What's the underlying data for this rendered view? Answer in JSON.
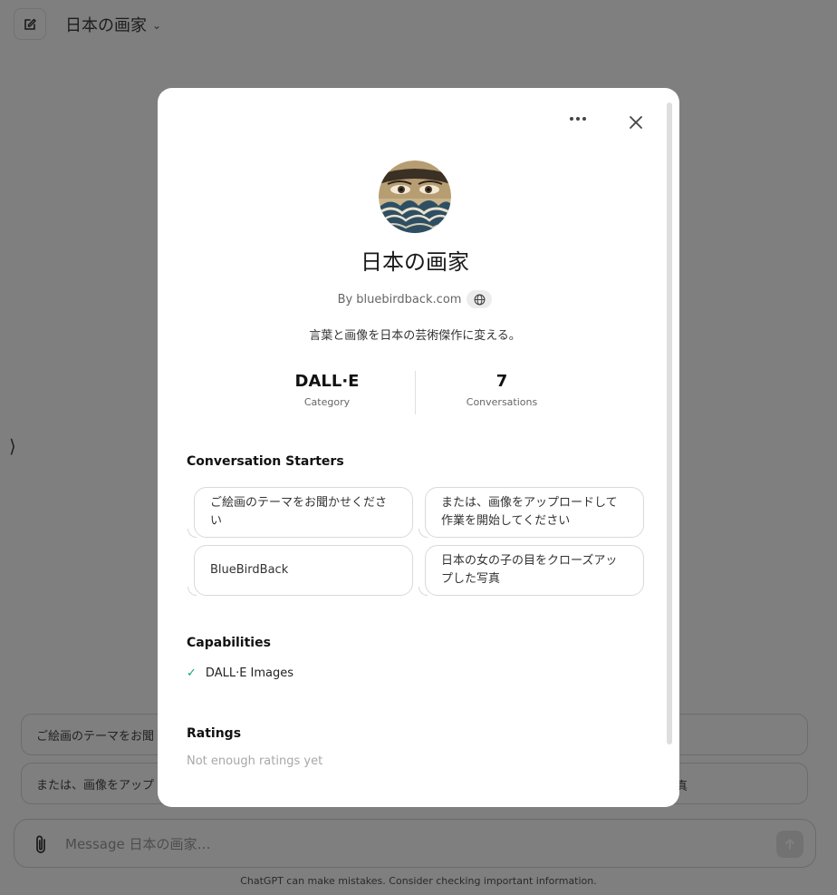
{
  "header": {
    "title": "日本の画家"
  },
  "background_starters": [
    {
      "text": "ご絵画のテーマをお聞"
    },
    {
      "text": "または、画像をアップ"
    },
    {
      "text": "真"
    }
  ],
  "composer": {
    "placeholder": "Message 日本の画家…",
    "disclaimer": "ChatGPT can make mistakes. Consider checking important information."
  },
  "modal": {
    "name": "日本の画家",
    "author": "By bluebirdback.com",
    "description": "言葉と画像を日本の芸術傑作に変える。",
    "stats": [
      {
        "value": "DALL·E",
        "label": "Category"
      },
      {
        "value": "7",
        "label": "Conversations"
      }
    ],
    "starters_heading": "Conversation Starters",
    "starters": [
      "ご絵画のテーマをお聞かせください",
      "または、画像をアップロードして作業を開始してください",
      "BlueBirdBack",
      "日本の女の子の目をクローズアップした写真"
    ],
    "capabilities_heading": "Capabilities",
    "capabilities": [
      "DALL·E Images"
    ],
    "ratings_heading": "Ratings",
    "ratings_empty": "Not enough ratings yet"
  },
  "colors": {
    "overlay": "#000000",
    "check": "#10a37f",
    "modal_bg": "#ffffff"
  },
  "icons": [
    "new-chat-icon",
    "chevron-down-icon",
    "sidebar-toggle-icon",
    "paperclip-icon",
    "send-arrow-icon",
    "more-icon",
    "close-icon",
    "globe-icon",
    "check-icon"
  ]
}
